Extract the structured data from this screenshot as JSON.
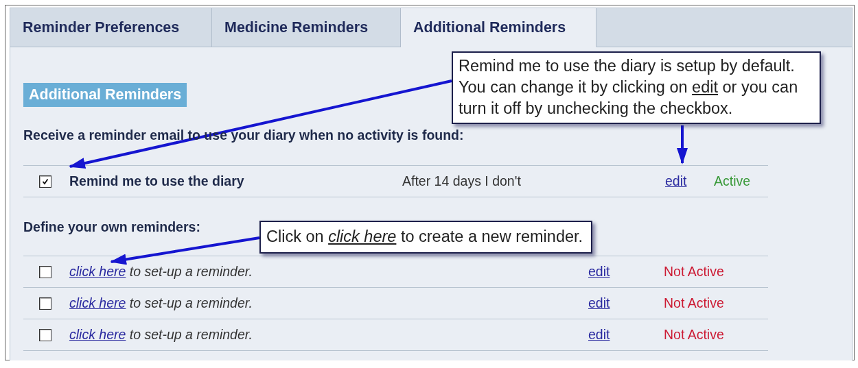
{
  "tabs": [
    {
      "label": "Reminder Preferences",
      "selected": false
    },
    {
      "label": "Medicine Reminders",
      "selected": false
    },
    {
      "label": "Additional Reminders",
      "selected": true
    }
  ],
  "section_heading": "Additional Reminders",
  "intro": "Receive a reminder email to use your diary when no activity is found:",
  "default_reminder": {
    "checked": true,
    "label": "Remind me to use the diary",
    "schedule": "After 14 days I don't",
    "edit": "edit",
    "status": "Active",
    "active": true
  },
  "custom_heading": "Define your own reminders:",
  "custom_reminders": [
    {
      "checked": false,
      "link": "click here",
      "text": " to set-up a reminder.",
      "edit": "edit",
      "status": "Not Active",
      "active": false
    },
    {
      "checked": false,
      "link": "click here",
      "text": " to set-up a reminder.",
      "edit": "edit",
      "status": "Not Active",
      "active": false
    },
    {
      "checked": false,
      "link": "click here",
      "text": " to set-up a reminder.",
      "edit": "edit",
      "status": "Not Active",
      "active": false
    }
  ],
  "callouts": [
    {
      "kind": "checkbox-hint",
      "before": "Remind me to use the diary is setup by default. You can change it by clicking on ",
      "link": "edit",
      "after": " or you can turn it off by unchecking the checkbox."
    },
    {
      "kind": "link-hint",
      "before": "Click on ",
      "link": "click here",
      "after": " to create a new reminder."
    }
  ]
}
